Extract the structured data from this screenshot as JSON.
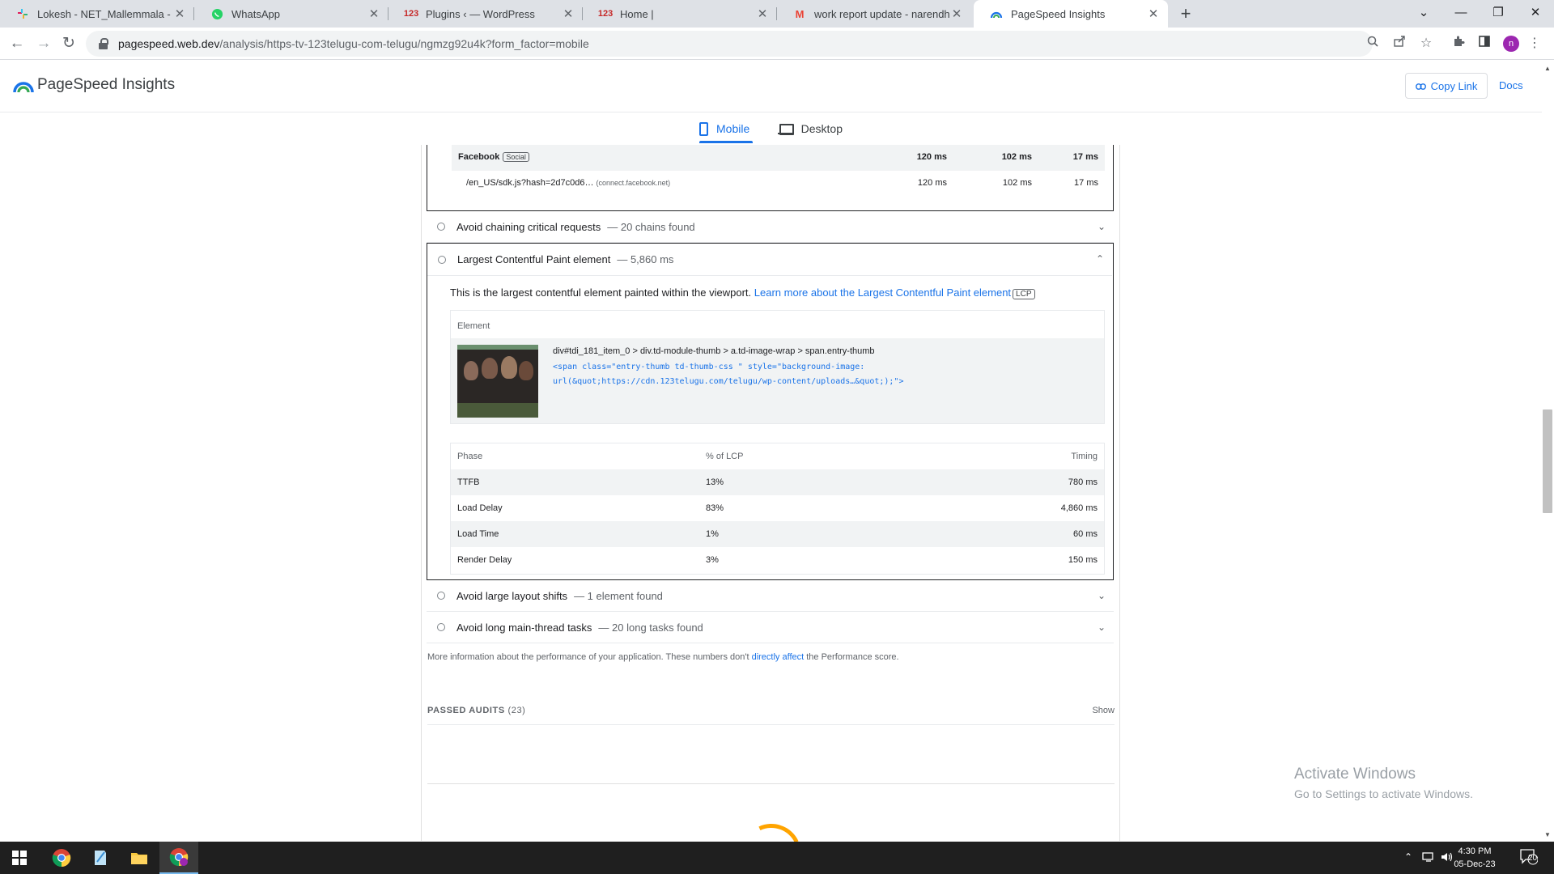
{
  "browser": {
    "tabs": [
      {
        "title": "Lokesh - NET_Mallemmala - Slac",
        "icon": "slack-icon"
      },
      {
        "title": "WhatsApp",
        "icon": "whatsapp-icon"
      },
      {
        "title": "Plugins ‹ — WordPress",
        "icon": "123-icon",
        "favicon_text": "123"
      },
      {
        "title": "Home |",
        "icon": "123-icon",
        "favicon_text": "123"
      },
      {
        "title": "work report update - narendhar",
        "icon": "gmail-icon",
        "favicon_text": "M"
      },
      {
        "title": "PageSpeed Insights",
        "icon": "pagespeed-icon",
        "active": true
      }
    ],
    "url_host": "pagespeed.web.dev",
    "url_path": "/analysis/https-tv-123telugu-com-telugu/ngmzg92u4k?form_factor=mobile",
    "profile_initial": "n"
  },
  "psi": {
    "title": "PageSpeed Insights",
    "copy_link": "Copy Link",
    "docs": "Docs",
    "tabs": {
      "mobile": "Mobile",
      "desktop": "Desktop"
    }
  },
  "facebook_table": {
    "group": "Facebook",
    "group_badge": "Social",
    "group_values": [
      "120 ms",
      "102 ms",
      "17 ms"
    ],
    "row_url": "/en_US/sdk.js?hash=2d7c0d6…",
    "row_host": "(connect.facebook.net)",
    "row_values": [
      "120 ms",
      "102 ms",
      "17 ms"
    ]
  },
  "audits": {
    "chaining": {
      "name": "Avoid chaining critical requests",
      "display": "— 20 chains found"
    },
    "lcp": {
      "name": "Largest Contentful Paint element",
      "display": "— 5,860 ms"
    },
    "layout_shifts": {
      "name": "Avoid large layout shifts",
      "display": "— 1 element found"
    },
    "long_tasks": {
      "name": "Avoid long main-thread tasks",
      "display": "— 20 long tasks found"
    }
  },
  "lcp_detail": {
    "description": "This is the largest contentful element painted within the viewport.",
    "learn_more": "Learn more about the Largest Contentful Paint element",
    "tag": "LCP",
    "element_header": "Element",
    "selector": "div#tdi_181_item_0 > div.td-module-thumb > a.td-image-wrap > span.entry-thumb",
    "snippet_line1": "<span class=\"entry-thumb td-thumb-css \" style=\"background-image:",
    "snippet_line2": "url(&quot;https://cdn.123telugu.com/telugu/wp-content/uploads…&quot;);\">",
    "phase_headers": [
      "Phase",
      "% of LCP",
      "Timing"
    ],
    "phases": [
      {
        "phase": "TTFB",
        "pct": "13%",
        "timing": "780 ms"
      },
      {
        "phase": "Load Delay",
        "pct": "83%",
        "timing": "4,860 ms"
      },
      {
        "phase": "Load Time",
        "pct": "1%",
        "timing": "60 ms"
      },
      {
        "phase": "Render Delay",
        "pct": "3%",
        "timing": "150 ms"
      }
    ]
  },
  "more_info": {
    "before": "More information about the performance of your application. These numbers don't",
    "link": "directly affect",
    "after": "the Performance score."
  },
  "passed_audits": {
    "label": "PASSED AUDITS",
    "count": "(23)",
    "show": "Show"
  },
  "watermark": {
    "line1": "Activate Windows",
    "line2": "Go to Settings to activate Windows."
  },
  "taskbar": {
    "time": "4:30 PM",
    "date": "05-Dec-23",
    "notif_count": "20"
  }
}
